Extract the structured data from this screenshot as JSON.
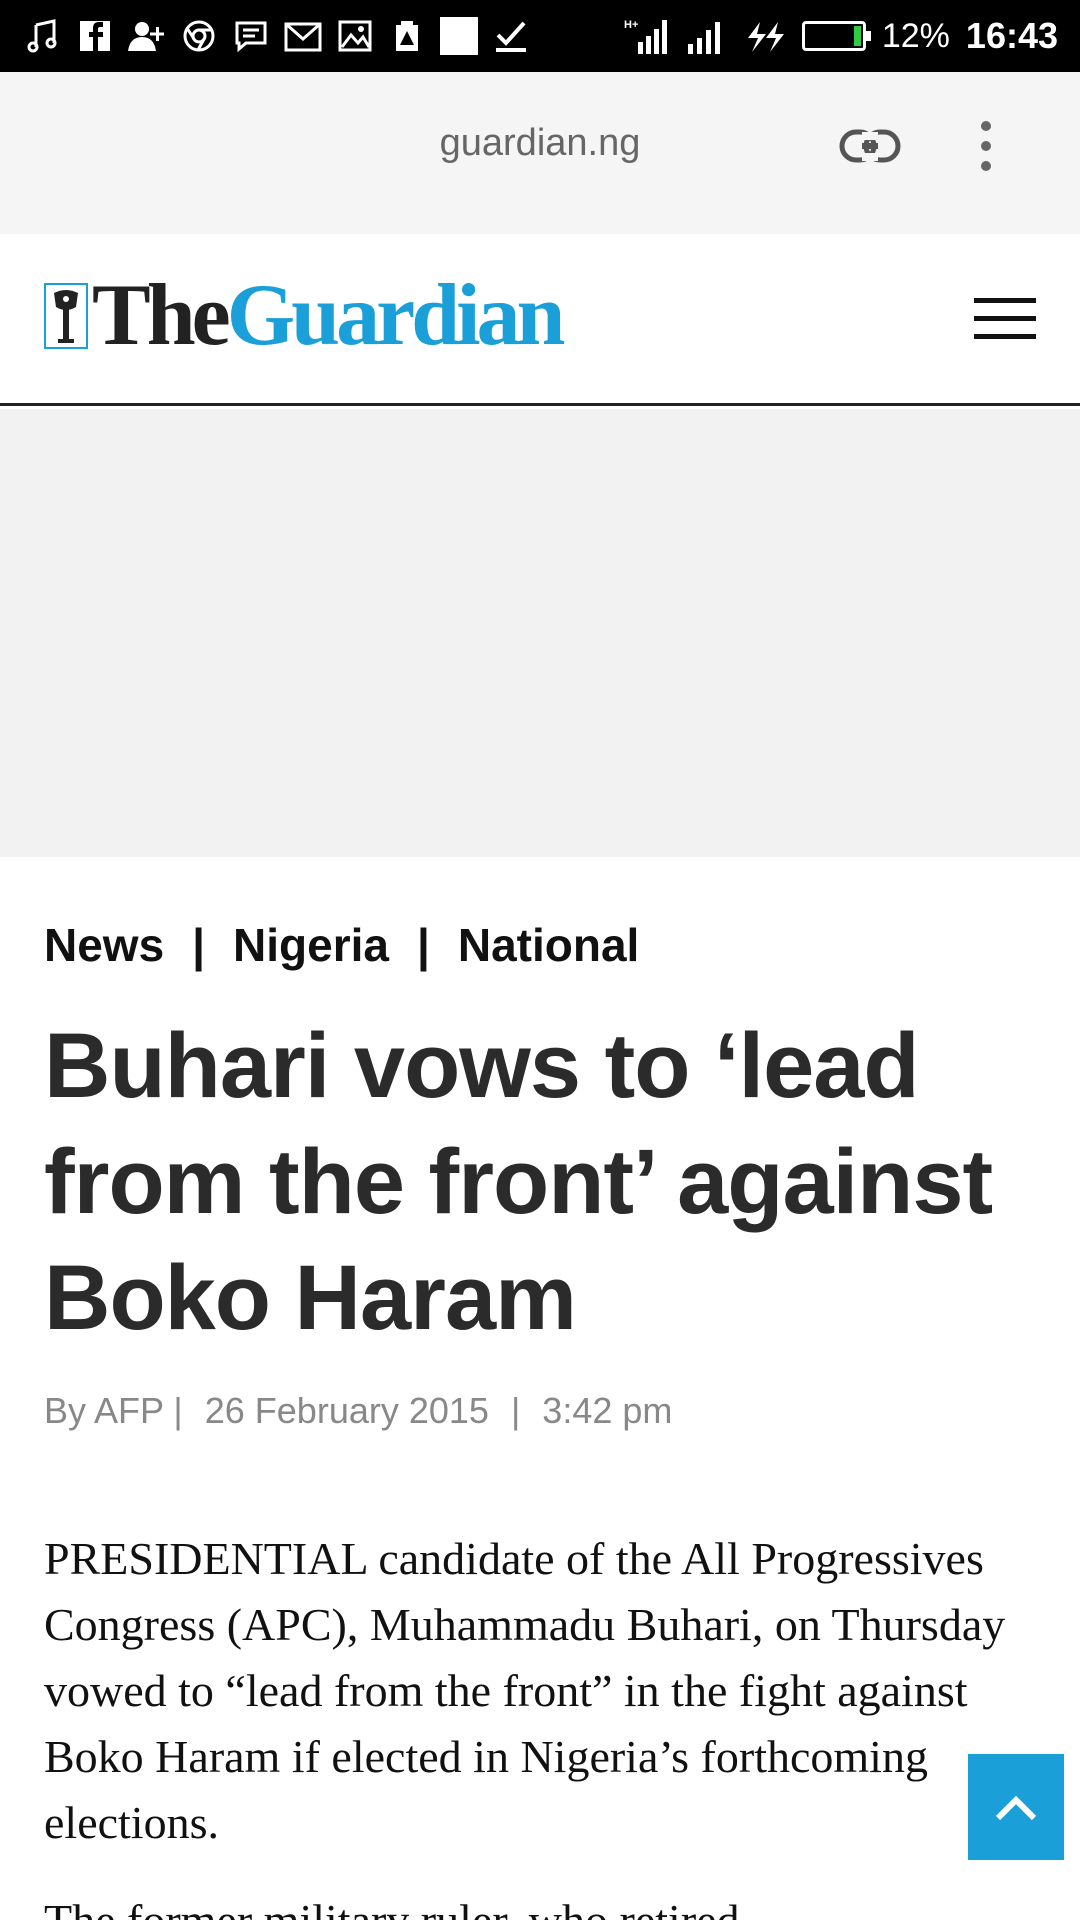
{
  "status_bar": {
    "battery_percent": "12%",
    "battery_level": 0.12,
    "time": "16:43",
    "left_icons": [
      "music-icon",
      "facebook-icon",
      "add-user-icon",
      "chrome-icon",
      "message-icon",
      "gmail-icon",
      "image-icon",
      "alert-icon",
      "blank-square-icon",
      "check-icon"
    ],
    "right_icons": [
      "signal-ht-icon",
      "signal-bars-icon",
      "charging-icon",
      "battery-icon"
    ]
  },
  "browser": {
    "url": "guardian.ng",
    "link_icon": "link-icon",
    "menu_icon": "more-vertical-icon"
  },
  "site": {
    "logo_the": "The",
    "logo_guardian": "Guardian",
    "brand_color": "#1a9fd9",
    "menu_icon": "hamburger-icon"
  },
  "article": {
    "breadcrumb": [
      "News",
      "Nigeria",
      "National"
    ],
    "breadcrumb_separator": "|",
    "headline": "Buhari vows to ‘lead from the front’ against Boko Haram",
    "byline_author": "By AFP |",
    "byline_date": "26 February 2015",
    "byline_sep": "|",
    "byline_time": "3:42 pm",
    "body_first": "PRESIDENTIAL candidate of the All Progressives Congress (APC), Muhammadu Buhari, on Thursday vowed to “lead from the front” in the fight against Boko Haram if elected in Nigeria’s forthcoming elections.",
    "body_second": "The former military ruler, who retired"
  },
  "scroll_top": {
    "icon": "chevron-up-icon"
  }
}
